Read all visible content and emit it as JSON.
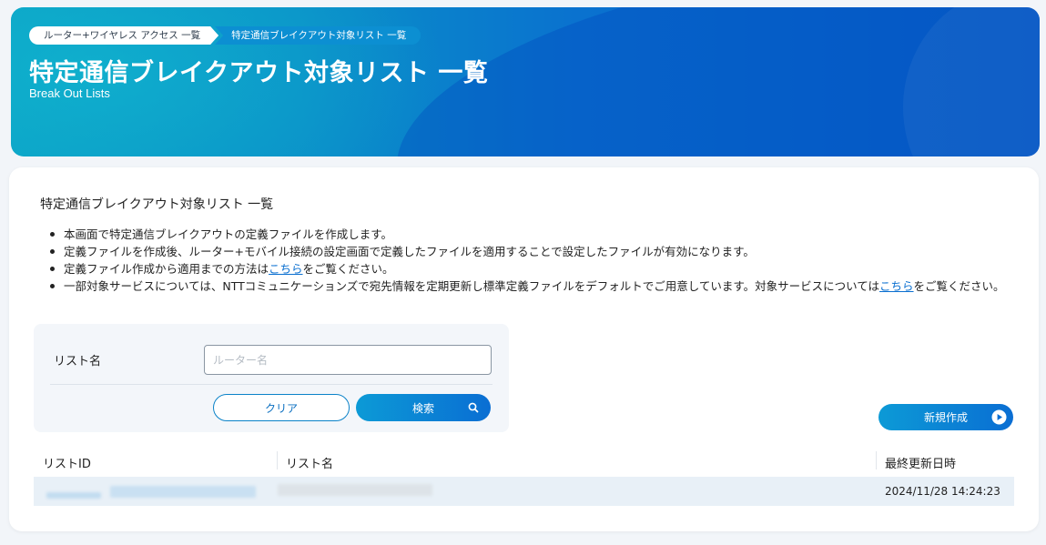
{
  "breadcrumb": {
    "items": [
      "ルーター+ワイヤレス アクセス 一覧",
      "特定通信ブレイクアウト対象リスト 一覧"
    ]
  },
  "header": {
    "title": "特定通信ブレイクアウト対象リスト 一覧",
    "subtitle": "Break Out Lists"
  },
  "main": {
    "section_title": "特定通信ブレイクアウト対象リスト 一覧",
    "notes": [
      {
        "text": "本画面で特定通信ブレイクアウトの定義ファイルを作成します。"
      },
      {
        "text": "定義ファイルを作成後、ルーター+モバイル接続の設定画面で定義したファイルを適用することで設定したファイルが有効になります。"
      },
      {
        "before": "定義ファイル作成から適用までの方法は",
        "link": "こちら",
        "after": "をご覧ください。"
      },
      {
        "before": "一部対象サービスについては、NTTコミュニケーションズで宛先情報を定期更新し標準定義ファイルをデフォルトでご用意しています。対象サービスについては",
        "link": "こちら",
        "after": "をご覧ください。"
      }
    ]
  },
  "search": {
    "label": "リスト名",
    "placeholder": "ルーター名",
    "value": "",
    "clear_label": "クリア",
    "search_label": "検索"
  },
  "actions": {
    "new_label": "新規作成"
  },
  "table": {
    "columns": [
      "リストID",
      "リスト名",
      "最終更新日時"
    ],
    "rows": [
      {
        "updated": "2024/11/28 14:24:23"
      }
    ]
  },
  "icons": {
    "search": "search-icon",
    "new": "play-circle-icon"
  },
  "colors": {
    "brand_start": "#0c9ad6",
    "brand_end": "#0a6ed3",
    "link": "#0a6fd0",
    "row_highlight": "#e8f0f7"
  }
}
